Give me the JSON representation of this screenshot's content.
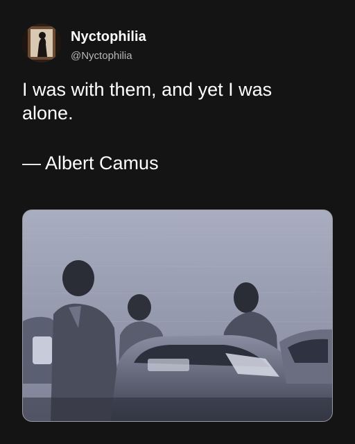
{
  "post": {
    "author": {
      "display_name": "Nyctophilia",
      "handle": "@Nyctophilia",
      "avatar_icon": "profile-picture"
    },
    "quote_lines": [
      "I was with them, and yet I was",
      "alone."
    ],
    "attribution": "— Albert Camus",
    "media": {
      "type": "photo",
      "description_icon": "black-and-white-photo-of-people-near-cars"
    }
  },
  "colors": {
    "background": "#141414",
    "text_primary": "#ffffff",
    "text_secondary": "#b8b8b8",
    "photo_border": "#9a9ba3"
  }
}
